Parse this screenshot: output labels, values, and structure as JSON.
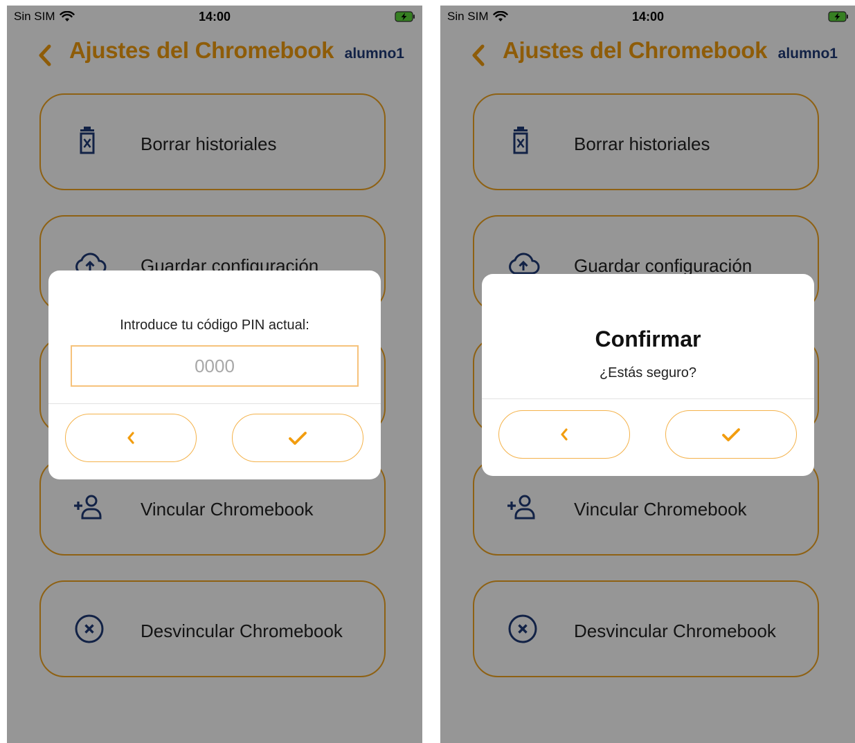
{
  "status_bar": {
    "carrier": "Sin SIM",
    "time": "14:00"
  },
  "header": {
    "title": "Ajustes del Chromebook",
    "user": "alumno1"
  },
  "menu": {
    "items": [
      {
        "label": "Borrar historiales",
        "icon": "trash-icon"
      },
      {
        "label": "Guardar configuración",
        "icon": "cloud-upload-icon"
      },
      {
        "label": "",
        "icon": ""
      },
      {
        "label": "Vincular Chromebook",
        "icon": "add-user-icon"
      },
      {
        "label": "Desvincular Chromebook",
        "icon": "circle-x-icon"
      }
    ]
  },
  "pin_dialog": {
    "prompt": "Introduce tu código PIN actual:",
    "placeholder": "0000",
    "value": ""
  },
  "confirm_dialog": {
    "title": "Confirmar",
    "message": "¿Estás seguro?"
  },
  "colors": {
    "accent": "#f29d0f",
    "card_border": "#f2a521",
    "icon_blue": "#1f3a78",
    "overlay": "rgba(0,0,0,0.41)",
    "battery_green": "#5dd83a"
  }
}
